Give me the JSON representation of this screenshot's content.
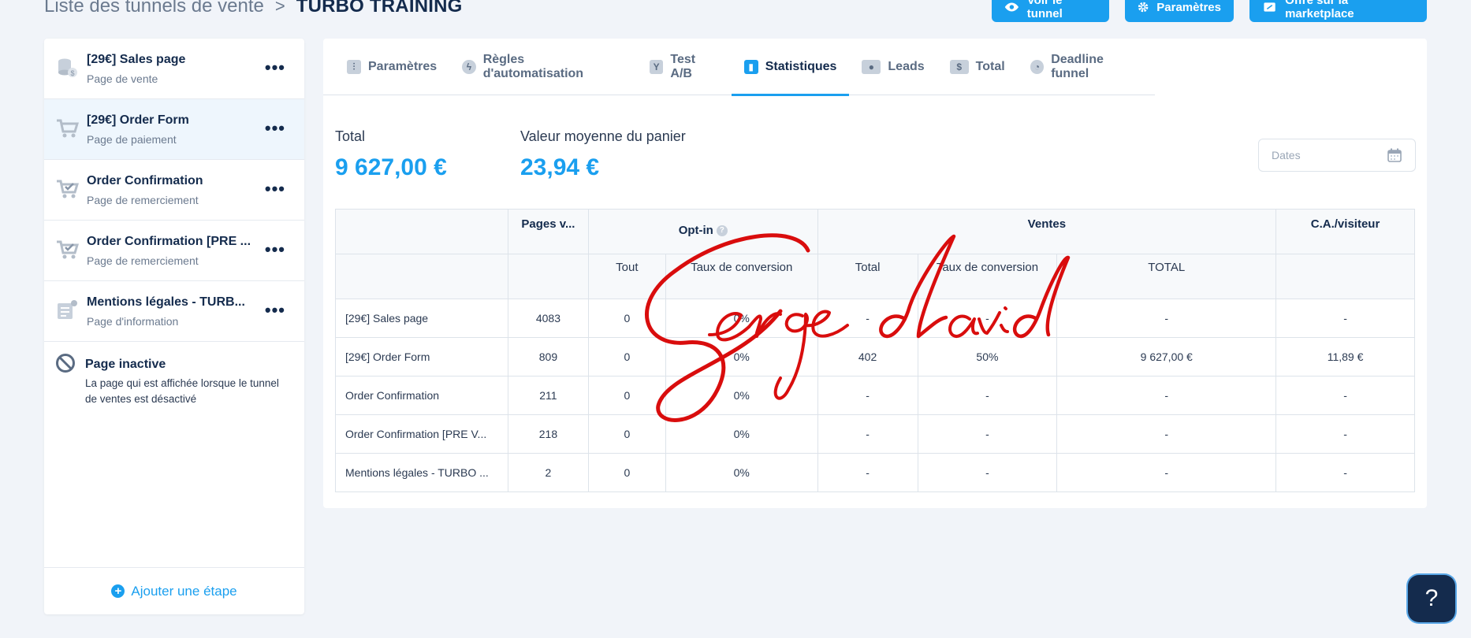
{
  "breadcrumb": {
    "parent": "Liste des tunnels de vente",
    "separator": ">",
    "current": "TURBO TRAINING"
  },
  "header_buttons": {
    "view": "Voir le tunnel",
    "settings": "Paramètres",
    "marketplace": "Offre sur la marketplace"
  },
  "sidebar": {
    "steps": [
      {
        "title": "[29€] Sales page",
        "subtitle": "Page de vente",
        "icon": "coins-icon",
        "menu": "•••"
      },
      {
        "title": "[29€] Order Form",
        "subtitle": "Page de paiement",
        "icon": "cart-icon",
        "menu": "•••"
      },
      {
        "title": "Order Confirmation",
        "subtitle": "Page de remerciement",
        "icon": "cart-check-icon",
        "menu": "•••"
      },
      {
        "title": "Order Confirmation [PRE ...",
        "subtitle": "Page de remerciement",
        "icon": "cart-check-icon",
        "menu": "•••"
      },
      {
        "title": "Mentions légales - TURB...",
        "subtitle": "Page d'information",
        "icon": "info-page-icon",
        "menu": "•••"
      }
    ],
    "inactive": {
      "title": "Page inactive",
      "description": "La page qui est affichée lorsque le tunnel de ventes est désactivé"
    },
    "add_step": "Ajouter une étape"
  },
  "tabs": [
    {
      "label": "Paramètres",
      "icon": "sliders-icon",
      "glyph": "⫶"
    },
    {
      "label": "Règles d'automatisation",
      "icon": "bolt-icon",
      "glyph": "ϟ"
    },
    {
      "label": "Test A/B",
      "icon": "split-icon",
      "glyph": "Y"
    },
    {
      "label": "Statistiques",
      "icon": "chart-icon",
      "glyph": "▮"
    },
    {
      "label": "Leads",
      "icon": "users-icon",
      "glyph": "●"
    },
    {
      "label": "Total",
      "icon": "dollar-icon",
      "glyph": "$"
    },
    {
      "label": "Deadline funnel",
      "icon": "clock-icon",
      "glyph": "◔"
    }
  ],
  "active_tab": "Statistiques",
  "kpis": {
    "total_label": "Total",
    "total_value": "9 627,00 €",
    "avg_label": "Valeur moyenne du panier",
    "avg_value": "23,94 €"
  },
  "dates_filter": {
    "placeholder": "Dates"
  },
  "table": {
    "group_headers": {
      "pages": "Pages v...",
      "optin": "Opt-in",
      "ventes": "Ventes",
      "ca": "C.A./visiteur"
    },
    "sub_headers": {
      "optin_all": "Tout",
      "optin_rate": "Taux de conversion",
      "sales_total": "Total",
      "sales_rate": "Taux de conversion",
      "sales_amount": "TOTAL"
    },
    "rows": [
      {
        "name": "[29€] Sales page",
        "pages": "4083",
        "optin_all": "0",
        "optin_rate": "0%",
        "sales_total": "-",
        "sales_rate": "-",
        "amount": "-",
        "ca": "-"
      },
      {
        "name": "[29€] Order Form",
        "pages": "809",
        "optin_all": "0",
        "optin_rate": "0%",
        "sales_total": "402",
        "sales_rate": "50%",
        "amount": "9 627,00 €",
        "ca": "11,89 €"
      },
      {
        "name": "Order Confirmation",
        "pages": "211",
        "optin_all": "0",
        "optin_rate": "0%",
        "sales_total": "-",
        "sales_rate": "-",
        "amount": "-",
        "ca": "-"
      },
      {
        "name": "Order Confirmation [PRE V...",
        "pages": "218",
        "optin_all": "0",
        "optin_rate": "0%",
        "sales_total": "-",
        "sales_rate": "-",
        "amount": "-",
        "ca": "-"
      },
      {
        "name": "Mentions légales - TURBO ...",
        "pages": "2",
        "optin_all": "0",
        "optin_rate": "0%",
        "sales_total": "-",
        "sales_rate": "-",
        "amount": "-",
        "ca": "-"
      }
    ]
  },
  "watermark_signature": "Serge david",
  "help_button": "?",
  "colors": {
    "accent": "#1a9fef",
    "navy": "#142b4d",
    "signature": "#d90d0d"
  }
}
